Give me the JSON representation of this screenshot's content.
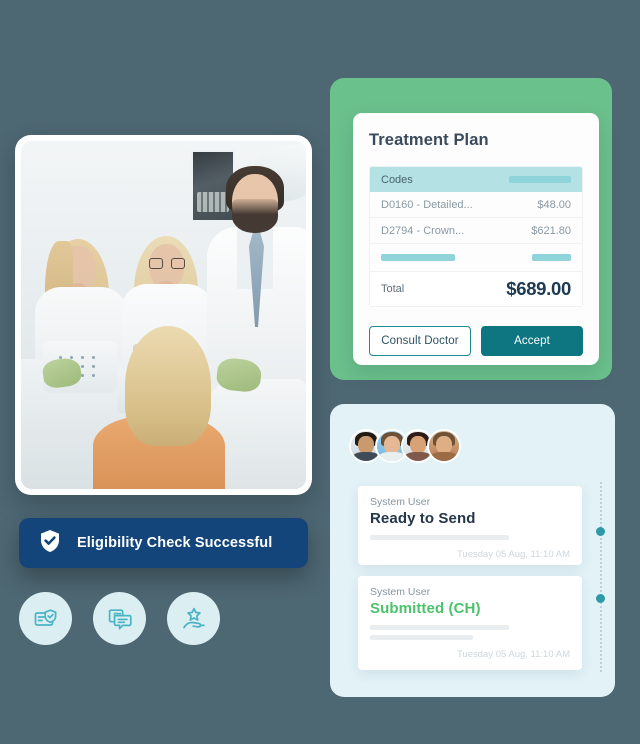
{
  "page": {
    "background_color": "#4D6773"
  },
  "photo": {
    "alt": "dental-clinic-team-with-patient",
    "scene": "Three dental staff in white coats standing behind a patient reclined in a dental chair"
  },
  "eligibility_banner": {
    "label": "Eligibility Check Successful",
    "icon": "shield-check-icon",
    "background_color": "#13457A",
    "text_color": "#FFFFFF"
  },
  "feature_icons": [
    {
      "name": "insurance-card-verified-icon",
      "label": "Insurance Verification"
    },
    {
      "name": "billing-chat-icon",
      "label": "Billing Communication"
    },
    {
      "name": "hand-star-icon",
      "label": "Quality Service"
    }
  ],
  "treatment_plan": {
    "title": "Treatment Plan",
    "accent_color": "#6BC18C",
    "table": {
      "header": {
        "label": "Codes",
        "placeholder_bar": true
      },
      "rows": [
        {
          "code": "D0160 -  Detailed...",
          "amount": "$48.00"
        },
        {
          "code": "D2794 - Crown...",
          "amount": "$621.80"
        }
      ],
      "skeleton_row": {
        "bar_long": true,
        "bar_short": true
      },
      "total": {
        "label": "Total",
        "amount": "$689.00"
      }
    },
    "actions": {
      "secondary": "Consult Doctor",
      "primary": "Accept"
    }
  },
  "timeline": {
    "background_color": "#E2F2F7",
    "avatars": [
      {
        "name": "avatar-user-1"
      },
      {
        "name": "avatar-user-2"
      },
      {
        "name": "avatar-user-3"
      },
      {
        "name": "avatar-user-4"
      }
    ],
    "messages": [
      {
        "user": "System User",
        "status": "Ready to Send",
        "status_color": "#24364A",
        "timestamp": "Tuesday 05 Aug, 11:10 AM"
      },
      {
        "user": "System User",
        "status": "Submitted (CH)",
        "status_color": "#4CC26B",
        "timestamp": "Tuesday 05 Aug, 11:10 AM"
      }
    ],
    "rail_dot_color": "#2E9AA8"
  }
}
